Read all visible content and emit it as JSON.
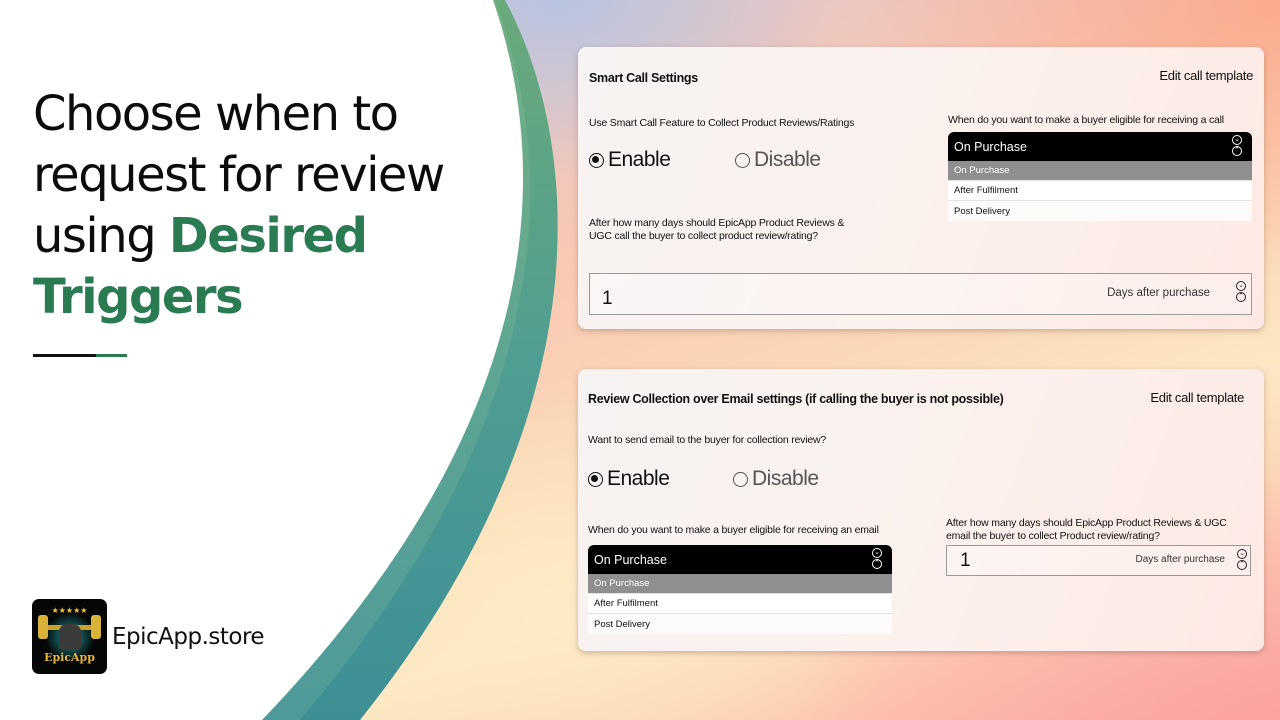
{
  "promo": {
    "headline_line1": "Choose when to",
    "headline_line2": "request for review",
    "headline_line3_plain": "using ",
    "headline_line3_accent": "Desired",
    "headline_line4_accent": "Triggers",
    "accent_color": "#2a7a52",
    "brand_name": "EpicApp.store",
    "logo_text": "EpicApp",
    "logo_stars": "★★★★★"
  },
  "smart_call": {
    "title": "Smart Call Settings",
    "edit_link": "Edit call template",
    "feature_label": "Use Smart Call Feature to Collect Product Reviews/Ratings",
    "radio_enable": "Enable",
    "radio_disable": "Disable",
    "selected_radio": "Enable",
    "eligibility_label": "When do you want to make a buyer eligible for receiving a call",
    "eligibility_selected": "On Purchase",
    "eligibility_options": [
      "On Purchase",
      "After Fulfilment",
      "Post Delivery"
    ],
    "days_label": "After how many days should EpicApp Product Reviews & UGC call the buyer to collect product review/rating?",
    "days_label_line1": "After how many days should EpicApp Product Reviews &",
    "days_label_line2": "UGC call the buyer to collect product review/rating?",
    "days_value": "1",
    "days_suffix": "Days after purchase"
  },
  "email": {
    "title": "Review Collection over Email settings (if calling the buyer is not possible)",
    "edit_link": "Edit call template",
    "feature_label": "Want to send email to the buyer for collection review?",
    "radio_enable": "Enable",
    "radio_disable": "Disable",
    "selected_radio": "Enable",
    "eligibility_label": "When do you want to make a buyer eligible for receiving an email",
    "eligibility_selected": "On Purchase",
    "eligibility_options": [
      "On Purchase",
      "After Fulfilment",
      "Post Delivery"
    ],
    "days_label_line1": "After how many days should EpicApp Product Reviews & UGC",
    "days_label_line2": "email the buyer to collect Product review/rating?",
    "days_value": "1",
    "days_suffix": "Days after purchase"
  },
  "icons": {
    "chevron_down": "⌄",
    "chevron_up": "⌃"
  }
}
